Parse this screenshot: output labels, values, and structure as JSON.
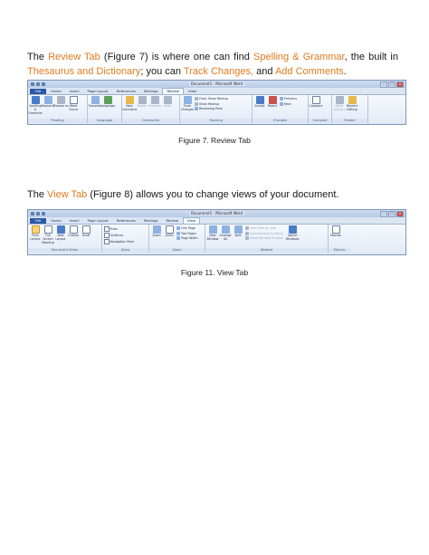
{
  "paragraph1": {
    "t1": "The ",
    "review_tab": "Review Tab",
    "t2": " (Figure 7) is where one can find ",
    "spelling_grammar": "Spelling & Grammar",
    "t3": ", the built in ",
    "thesaurus_dictionary": "Thesaurus and Dictionary",
    "t4": "; you can ",
    "track_changes": "Track Changes,",
    "t5": " and ",
    "add_comments": "Add Comments",
    "t6": "."
  },
  "caption1": "Figure 7. Review Tab",
  "paragraph2": {
    "t1": "The ",
    "view_tab": "View Tab",
    "t2": " (Figure 8) allows you to change views of your document."
  },
  "caption2": "Figure 11. View Tab",
  "review_ribbon": {
    "title": "Document1 - Microsoft Word",
    "tabs": [
      "File",
      "Home",
      "Insert",
      "Page Layout",
      "References",
      "Mailings",
      "Review",
      "View"
    ],
    "proofing": {
      "label": "Proofing",
      "spelling": "Spelling & Grammar",
      "research": "Research",
      "thesaurus": "Thesaurus",
      "word_count": "Word Count"
    },
    "language": {
      "label": "Language",
      "translate": "Translate",
      "language": "Language"
    },
    "comments": {
      "label": "Comments",
      "new_comment": "New Comment",
      "delete": "Delete",
      "previous": "Previous",
      "next": "Next"
    },
    "tracking": {
      "label": "Tracking",
      "track_changes": "Track Changes",
      "final_markup": "Final: Show Markup",
      "show_markup": "Show Markup",
      "reviewing_pane": "Reviewing Pane"
    },
    "changes": {
      "label": "Changes",
      "accept": "Accept",
      "reject": "Reject",
      "previous": "Previous",
      "next": "Next"
    },
    "compare": {
      "label": "Compare",
      "compare": "Compare"
    },
    "protect": {
      "label": "Protect",
      "block_authors": "Block Authors",
      "restrict_editing": "Restrict Editing"
    }
  },
  "view_ribbon": {
    "title": "Document1 - Microsoft Word",
    "tabs": [
      "File",
      "Home",
      "Insert",
      "Page Layout",
      "References",
      "Mailings",
      "Review",
      "View"
    ],
    "document_views": {
      "label": "Document Views",
      "print_layout": "Print Layout",
      "full_screen": "Full Screen Reading",
      "web_layout": "Web Layout",
      "outline": "Outline",
      "draft": "Draft"
    },
    "show": {
      "label": "Show",
      "ruler": "Ruler",
      "gridlines": "Gridlines",
      "navigation_pane": "Navigation Pane"
    },
    "zoom": {
      "label": "Zoom",
      "zoom": "Zoom",
      "percent": "100%",
      "one_page": "One Page",
      "two_pages": "Two Pages",
      "page_width": "Page Width"
    },
    "window": {
      "label": "Window",
      "new_window": "New Window",
      "arrange_all": "Arrange All",
      "split": "Split",
      "view_side_by_side": "View Side by Side",
      "sync_scrolling": "Synchronous Scrolling",
      "reset_window": "Reset Window Position",
      "switch_windows": "Switch Windows"
    },
    "macros": {
      "label": "Macros",
      "macros": "Macros"
    }
  }
}
